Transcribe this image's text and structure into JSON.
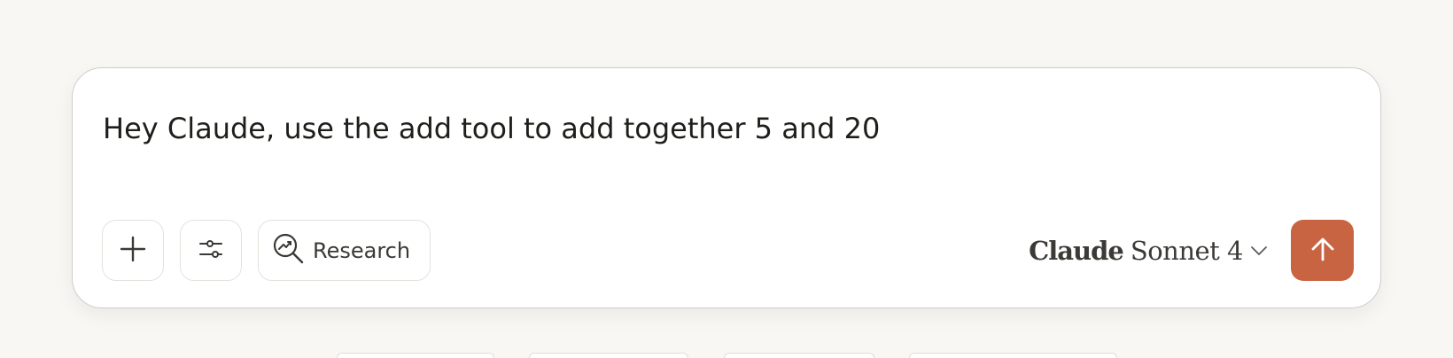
{
  "composer": {
    "text": "Hey Claude, use the add tool to add together 5 and 20",
    "buttons": {
      "add_icon": "plus-icon",
      "settings_icon": "sliders-icon",
      "research_icon": "research-icon",
      "research_label": "Research"
    },
    "model": {
      "brand": "Claude",
      "variant": "Sonnet 4",
      "chevron_icon": "chevron-down-icon"
    },
    "send_icon": "arrow-up-icon"
  },
  "colors": {
    "page_background": "#f8f7f3",
    "composer_background": "#ffffff",
    "send_button": "#c96442",
    "text": "#1f1e1a"
  }
}
